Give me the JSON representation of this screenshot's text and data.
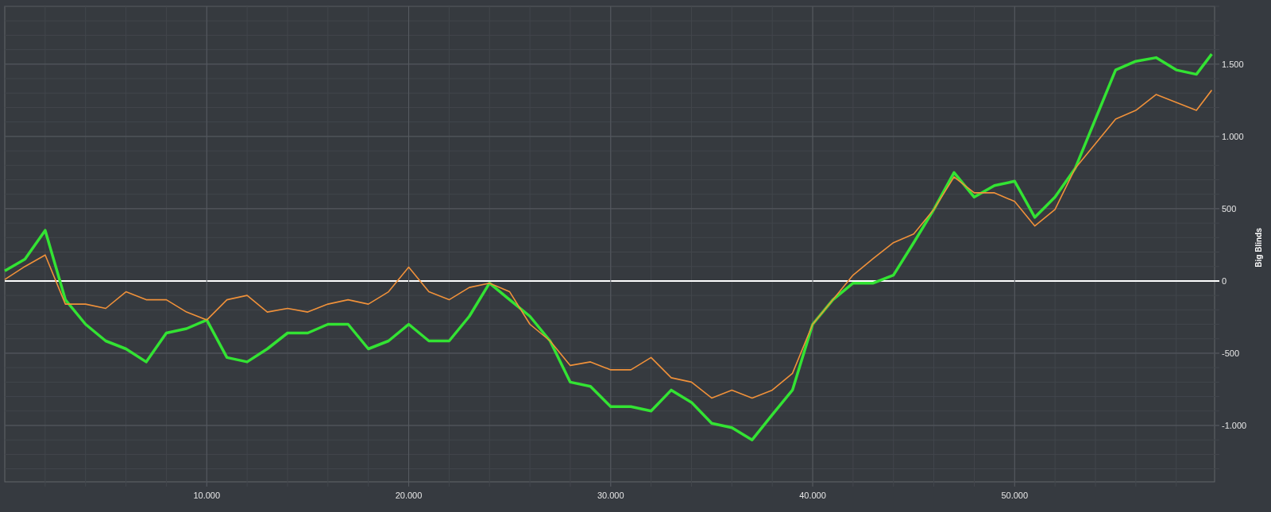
{
  "chart_data": {
    "type": "line",
    "grid": true,
    "ylabel": "Big Blinds",
    "x": [
      0,
      1000,
      2000,
      3000,
      4000,
      5000,
      6000,
      7000,
      8000,
      9000,
      10000,
      11000,
      12000,
      13000,
      14000,
      15000,
      16000,
      17000,
      18000,
      19000,
      20000,
      21000,
      22000,
      23000,
      24000,
      25000,
      26000,
      27000,
      28000,
      29000,
      30000,
      31000,
      32000,
      33000,
      34000,
      35000,
      36000,
      37000,
      38000,
      39000,
      40000,
      41000,
      42000,
      43000,
      44000,
      45000,
      46000,
      47000,
      48000,
      49000,
      50000,
      51000,
      52000,
      53000,
      54000,
      55000,
      56000,
      57000,
      58000,
      59000,
      59760
    ],
    "series": [
      {
        "color": "#33e333",
        "values": [
          70,
          150,
          350,
          -130,
          -300,
          -415,
          -470,
          -560,
          -360,
          -330,
          -270,
          -530,
          -560,
          -470,
          -360,
          -360,
          -300,
          -300,
          -470,
          -415,
          -300,
          -415,
          -415,
          -245,
          -15,
          -130,
          -245,
          -415,
          -700,
          -730,
          -870,
          -870,
          -900,
          -755,
          -840,
          -985,
          -1015,
          -1100,
          -925,
          -755,
          -300,
          -130,
          -15,
          -15,
          40,
          265,
          495,
          750,
          580,
          660,
          690,
          440,
          580,
          780,
          1120,
          1460,
          1520,
          1545,
          1460,
          1430,
          1570
        ]
      },
      {
        "color": "#f0913a",
        "values": [
          10,
          100,
          180,
          -160,
          -160,
          -190,
          -75,
          -130,
          -130,
          -215,
          -270,
          -130,
          -100,
          -215,
          -190,
          -215,
          -160,
          -130,
          -160,
          -75,
          95,
          -75,
          -130,
          -45,
          -15,
          -75,
          -300,
          -415,
          -585,
          -560,
          -615,
          -615,
          -530,
          -670,
          -700,
          -810,
          -755,
          -810,
          -755,
          -640,
          -300,
          -130,
          40,
          155,
          265,
          325,
          495,
          720,
          610,
          610,
          550,
          380,
          495,
          780,
          950,
          1120,
          1180,
          1290,
          1235,
          1180,
          1320
        ]
      }
    ],
    "xlim": [
      0,
      59900
    ],
    "ylim": [
      -1390,
      1900
    ],
    "xticks": [
      {
        "value": 10000,
        "label": "10.000"
      },
      {
        "value": 20000,
        "label": "20.000"
      },
      {
        "value": 30000,
        "label": "30.000"
      },
      {
        "value": 40000,
        "label": "40.000"
      },
      {
        "value": 50000,
        "label": "50.000"
      }
    ],
    "yticks": [
      {
        "value": -1000,
        "label": "-1.000"
      },
      {
        "value": -500,
        "label": "-500"
      },
      {
        "value": 0,
        "label": "0"
      },
      {
        "value": 500,
        "label": "500"
      },
      {
        "value": 1000,
        "label": "1.000"
      },
      {
        "value": 1500,
        "label": "1.500"
      }
    ]
  }
}
